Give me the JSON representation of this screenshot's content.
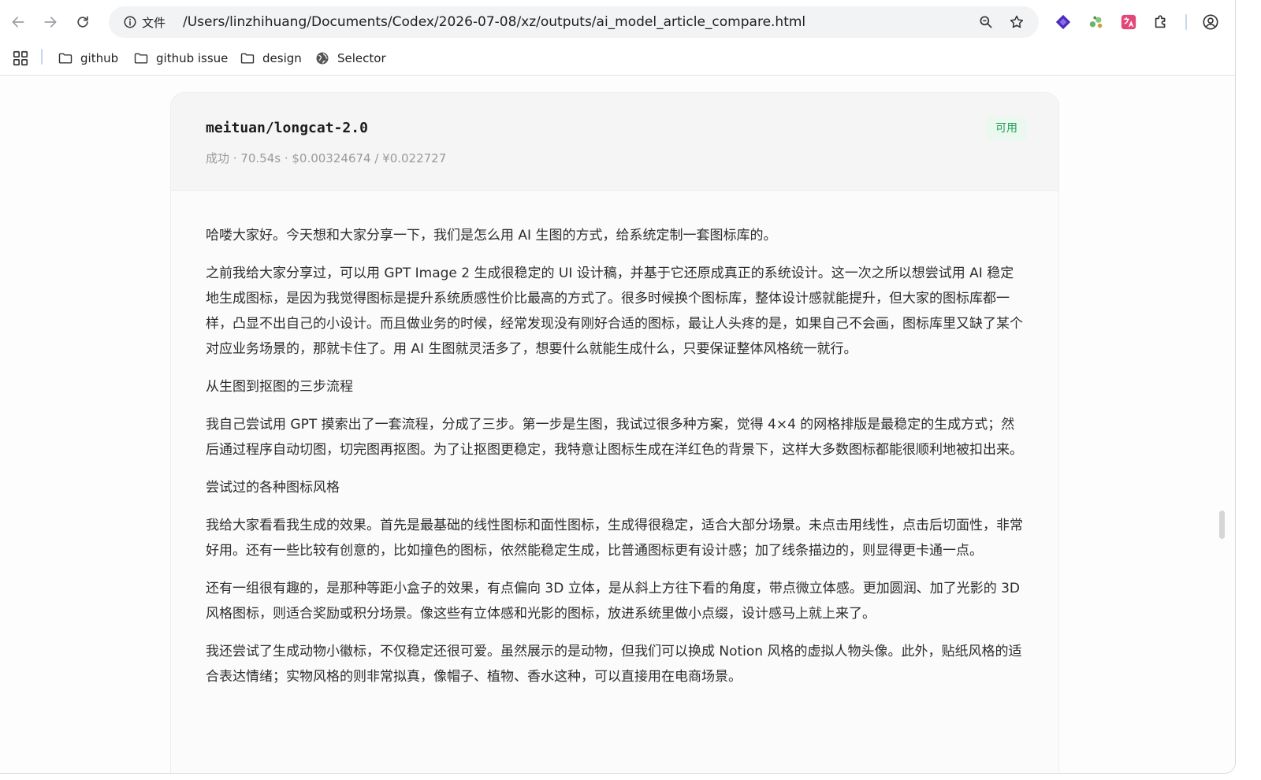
{
  "browser": {
    "site_info_label": "文件",
    "url": "/Users/linzhihuang/Documents/Codex/2026-07-08/xz/outputs/ai_model_article_compare.html"
  },
  "bookmarks": [
    {
      "label": "github",
      "icon": "folder-icon"
    },
    {
      "label": "github issue",
      "icon": "folder-icon"
    },
    {
      "label": "design",
      "icon": "folder-icon"
    },
    {
      "label": "Selector",
      "icon": "globe-icon"
    }
  ],
  "card": {
    "model_name": "meituan/longcat-2.0",
    "status": "可用",
    "meta": "成功 · 70.54s · $0.00324674 / ¥0.022727",
    "status_color": "#1e9e55"
  },
  "article": [
    {
      "type": "p",
      "text": "哈喽大家好。今天想和大家分享一下，我们是怎么用 AI 生图的方式，给系统定制一套图标库的。"
    },
    {
      "type": "p",
      "text": "之前我给大家分享过，可以用 GPT Image 2 生成很稳定的 UI 设计稿，并基于它还原成真正的系统设计。这一次之所以想尝试用 AI 稳定地生成图标，是因为我觉得图标是提升系统质感性价比最高的方式了。很多时候换个图标库，整体设计感就能提升，但大家的图标库都一样，凸显不出自己的小设计。而且做业务的时候，经常发现没有刚好合适的图标，最让人头疼的是，如果自己不会画，图标库里又缺了某个对应业务场景的，那就卡住了。用 AI 生图就灵活多了，想要什么就能生成什么，只要保证整体风格统一就行。"
    },
    {
      "type": "h",
      "text": "从生图到抠图的三步流程"
    },
    {
      "type": "p",
      "text": "我自己尝试用 GPT 摸索出了一套流程，分成了三步。第一步是生图，我试过很多种方案，觉得 4×4 的网格排版是最稳定的生成方式；然后通过程序自动切图，切完图再抠图。为了让抠图更稳定，我特意让图标生成在洋红色的背景下，这样大多数图标都能很顺利地被扣出来。"
    },
    {
      "type": "h",
      "text": "尝试过的各种图标风格"
    },
    {
      "type": "p",
      "text": "我给大家看看我生成的效果。首先是最基础的线性图标和面性图标，生成得很稳定，适合大部分场景。未点击用线性，点击后切面性，非常好用。还有一些比较有创意的，比如撞色的图标，依然能稳定生成，比普通图标更有设计感；加了线条描边的，则显得更卡通一点。"
    },
    {
      "type": "p",
      "text": "还有一组很有趣的，是那种等距小盒子的效果，有点偏向 3D 立体，是从斜上方往下看的角度，带点微立体感。更加圆润、加了光影的 3D 风格图标，则适合奖励或积分场景。像这些有立体感和光影的图标，放进系统里做小点缀，设计感马上就上来了。"
    },
    {
      "type": "p",
      "text": "我还尝试了生成动物小徽标，不仅稳定还很可爱。虽然展示的是动物，但我们可以换成 Notion 风格的虚拟人物头像。此外，贴纸风格的适合表达情绪；实物风格的则非常拟真，像帽子、植物、香水这种，可以直接用在电商场景。"
    }
  ]
}
